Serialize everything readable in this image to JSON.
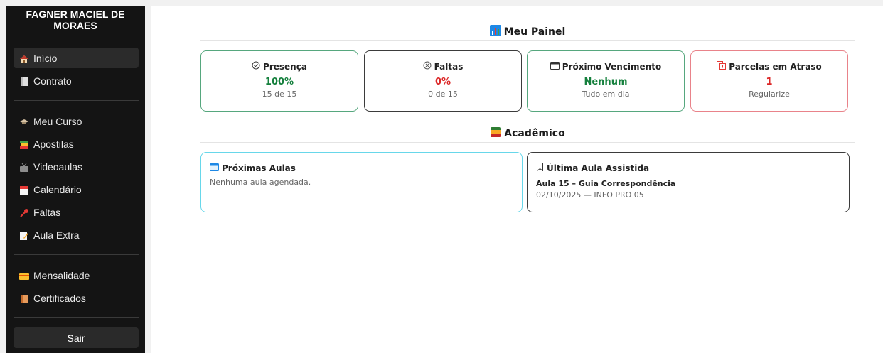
{
  "user": {
    "name": "FAGNER MACIEL DE MORAES"
  },
  "nav": {
    "group1": [
      {
        "label": "Início",
        "icon": "home-icon",
        "active": true
      },
      {
        "label": "Contrato",
        "icon": "document-icon"
      }
    ],
    "group2": [
      {
        "label": "Meu Curso",
        "icon": "graduation-cap-icon"
      },
      {
        "label": "Apostilas",
        "icon": "books-icon"
      },
      {
        "label": "Videoaulas",
        "icon": "video-icon"
      },
      {
        "label": "Calendário",
        "icon": "calendar-icon"
      },
      {
        "label": "Faltas",
        "icon": "pushpin-icon"
      },
      {
        "label": "Aula Extra",
        "icon": "memo-icon"
      }
    ],
    "group3": [
      {
        "label": "Mensalidade",
        "icon": "credit-card-icon"
      },
      {
        "label": "Certificados",
        "icon": "scroll-icon"
      }
    ],
    "logout_label": "Sair"
  },
  "dashboard": {
    "title": "Meu Painel",
    "cards": [
      {
        "title": "Presença",
        "value": "100%",
        "sub": "15 de 15",
        "icon": "check-circle-icon"
      },
      {
        "title": "Faltas",
        "value": "0%",
        "sub": "0 de 15",
        "icon": "x-circle-icon"
      },
      {
        "title": "Próximo Vencimento",
        "value": "Nenhum",
        "sub": "Tudo em dia",
        "icon": "calendar-icon"
      },
      {
        "title": "Parcelas em Atraso",
        "value": "1",
        "sub": "Regularize",
        "icon": "alert-icon"
      }
    ]
  },
  "academic": {
    "title": "Acadêmico",
    "next_classes": {
      "title": "Próximas Aulas",
      "text": "Nenhuma aula agendada."
    },
    "last_class": {
      "title": "Última Aula Assistida",
      "lesson": "Aula 15 – Guia Correspondência",
      "meta": "02/10/2025 — INFO PRO 05"
    }
  },
  "colors": {
    "green": "#15803d",
    "red": "#dc2626",
    "green_border": "#56a77e",
    "red_border": "#e9838a",
    "cyan_border": "#67d7ea",
    "dark_border": "#3b3b3b"
  }
}
